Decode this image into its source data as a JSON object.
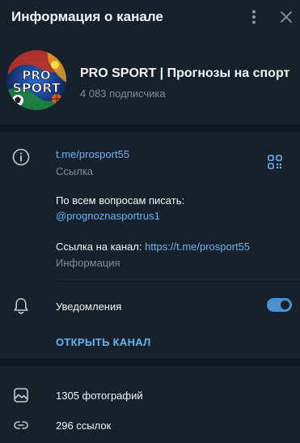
{
  "header": {
    "title": "Информация о канале"
  },
  "channel": {
    "name": "PRO SPORT | Прогнозы на спорт",
    "subscribers": "4 083 подписчика",
    "avatar_text": "PRO SPORT"
  },
  "info": {
    "link": "t.me/prosport55",
    "link_label": "Ссылка",
    "desc_line1": "По всем вопросам писать:",
    "desc_contact": "@prognoznasportrus1",
    "desc_line3_prefix": "Ссылка на канал: ",
    "desc_line3_link": "https://t.me/prosport55",
    "desc_label": "Информация"
  },
  "notifications": {
    "label": "Уведомления",
    "enabled": true
  },
  "open_channel": {
    "label": "ОТКРЫТЬ КАНАЛ"
  },
  "media": [
    {
      "label": "1305 фотографий",
      "icon": "photo-icon"
    },
    {
      "label": "296 ссылок",
      "icon": "link-icon"
    }
  ],
  "colors": {
    "background": "#17212b",
    "separator": "#0e1621",
    "accent": "#6ab3f3",
    "secondary_text": "#7f8b95",
    "toggle": "#4d8fd1"
  }
}
